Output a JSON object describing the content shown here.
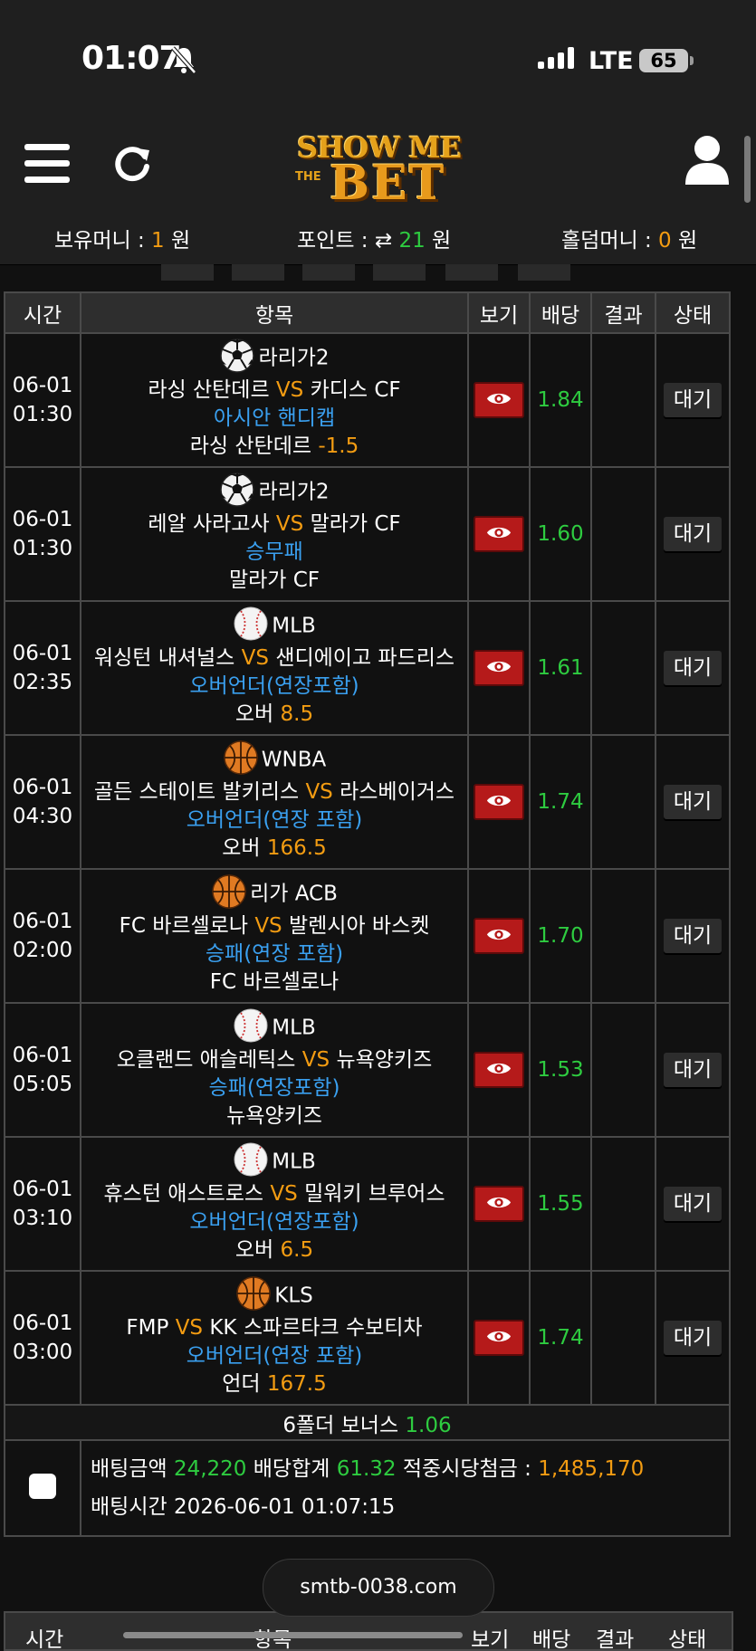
{
  "status": {
    "time": "01:07",
    "network": "LTE",
    "battery": "65"
  },
  "logo": {
    "top": "SHOW ME",
    "the": "THE",
    "bottom": "BET"
  },
  "balances": {
    "money_label": "보유머니 : ",
    "money_value": "1",
    "money_unit": " 원",
    "point_label": "포인트 : ",
    "point_icon": "⇄",
    "point_value": "21",
    "point_unit": " 원",
    "holdem_label": "홀덤머니 : ",
    "holdem_value": "0",
    "holdem_unit": " 원"
  },
  "table": {
    "headers": [
      "시간",
      "항목",
      "보기",
      "배당",
      "결과",
      "상태"
    ],
    "rows": [
      {
        "date": "06-01",
        "time": "01:30",
        "sport_icon": "soccer-ball-icon",
        "league": "라리가2",
        "home": "라싱 산탄데르",
        "vs": "VS",
        "away": "카디스 CF",
        "market": "아시안 핸디캡",
        "pick": "라싱 산탄데르",
        "pick_line": "-1.5",
        "odds": "1.84",
        "result": "",
        "state": "대기"
      },
      {
        "date": "06-01",
        "time": "01:30",
        "sport_icon": "soccer-ball-icon",
        "league": "라리가2",
        "home": "레알 사라고사",
        "vs": "VS",
        "away": "말라가 CF",
        "market": "승무패",
        "pick": "말라가 CF",
        "pick_line": "",
        "odds": "1.60",
        "result": "",
        "state": "대기"
      },
      {
        "date": "06-01",
        "time": "02:35",
        "sport_icon": "baseball-icon",
        "league": "MLB",
        "home": "워싱턴 내셔널스",
        "vs": "VS",
        "away": "샌디에이고 파드리스",
        "market": "오버언더(연장포함)",
        "pick": "오버",
        "pick_line": "8.5",
        "odds": "1.61",
        "result": "",
        "state": "대기"
      },
      {
        "date": "06-01",
        "time": "04:30",
        "sport_icon": "basketball-icon",
        "league": "WNBA",
        "home": "골든 스테이트 발키리스",
        "vs": "VS",
        "away": "라스베이거스",
        "market": "오버언더(연장 포함)",
        "pick": "오버",
        "pick_line": "166.5",
        "odds": "1.74",
        "result": "",
        "state": "대기"
      },
      {
        "date": "06-01",
        "time": "02:00",
        "sport_icon": "basketball-icon",
        "league": "리가 ACB",
        "home": "FC 바르셀로나",
        "vs": "VS",
        "away": "발렌시아 바스켓",
        "market": "승패(연장 포함)",
        "pick": "FC 바르셀로나",
        "pick_line": "",
        "odds": "1.70",
        "result": "",
        "state": "대기"
      },
      {
        "date": "06-01",
        "time": "05:05",
        "sport_icon": "baseball-icon",
        "league": "MLB",
        "home": "오클랜드 애슬레틱스",
        "vs": "VS",
        "away": "뉴욕양키즈",
        "market": "승패(연장포함)",
        "pick": "뉴욕양키즈",
        "pick_line": "",
        "odds": "1.53",
        "result": "",
        "state": "대기"
      },
      {
        "date": "06-01",
        "time": "03:10",
        "sport_icon": "baseball-icon",
        "league": "MLB",
        "home": "휴스턴 애스트로스",
        "vs": "VS",
        "away": "밀워키 브루어스",
        "market": "오버언더(연장포함)",
        "pick": "오버",
        "pick_line": "6.5",
        "odds": "1.55",
        "result": "",
        "state": "대기"
      },
      {
        "date": "06-01",
        "time": "03:00",
        "sport_icon": "basketball-icon",
        "league": "KLS",
        "home": "FMP",
        "vs": "VS",
        "away": "KK 스파르타크 수보티차",
        "market": "오버언더(연장 포함)",
        "pick": "언더",
        "pick_line": "167.5",
        "odds": "1.74",
        "result": "",
        "state": "대기"
      }
    ],
    "bonus": {
      "label": "6폴더 보너스 ",
      "value": "1.06"
    },
    "summary": {
      "amount_label": "배팅금액 ",
      "amount_value": "24,220",
      "total_label": " 배당합계 ",
      "total_value": "61.32",
      "payout_label": " 적중시당첨금 : ",
      "payout_value": "1,485,170",
      "time_label": "배팅시간 ",
      "time_value": "2026-06-01 01:07:15"
    }
  },
  "domain_pill": "smtb-0038.com",
  "colors": {
    "accent_orange": "#f39c12",
    "odds_green": "#2ecc40",
    "market_blue": "#3aa0f0",
    "view_red": "#b51a1a"
  }
}
